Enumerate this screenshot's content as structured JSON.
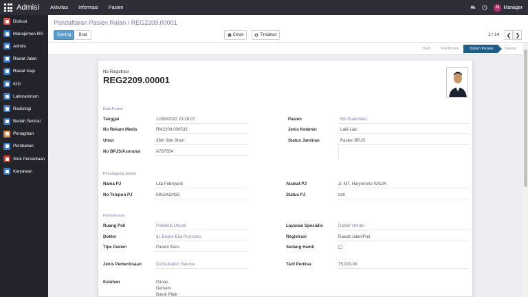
{
  "navbar": {
    "brand": "Admisi",
    "menu": [
      "Aktivitas",
      "Informasi",
      "Pasien"
    ],
    "user_initial": "M",
    "user_name": "Manager"
  },
  "sidebar": {
    "items": [
      {
        "label": "Diskusi",
        "color": "#d9534f"
      },
      {
        "label": "Manajemen RS",
        "color": "#3a7dc9"
      },
      {
        "label": "Admisi",
        "color": "#3a7dc9"
      },
      {
        "label": "Rawat Jalan",
        "color": "#3a7dc9"
      },
      {
        "label": "Rawat Inap",
        "color": "#3a7dc9"
      },
      {
        "label": "IGD",
        "color": "#3a7dc9"
      },
      {
        "label": "Laboratorium",
        "color": "#3a7dc9"
      },
      {
        "label": "Radiologi",
        "color": "#3a7dc9"
      },
      {
        "label": "Bedah Sentral",
        "color": "#3a7dc9"
      },
      {
        "label": "Penagihan",
        "color": "#e08a3a"
      },
      {
        "label": "Pembelian",
        "color": "#3a7dc9"
      },
      {
        "label": "Stok Persediaan",
        "color": "#c0392b"
      },
      {
        "label": "Karyawan",
        "color": "#3a7dc9"
      }
    ]
  },
  "control": {
    "breadcrumb": "Pendaftaran Pasien Ralan / REG2209.00001",
    "edit_label": "Sunting",
    "create_label": "Buat",
    "print_label": "Cetak",
    "action_label": "Tindakan",
    "pager": "1 / 14",
    "prev": "❮",
    "next": "❯"
  },
  "status_stages": [
    {
      "label": "Draft",
      "active": false
    },
    {
      "label": "Konfirmasi",
      "active": false
    },
    {
      "label": "Dalam Proses",
      "active": true
    },
    {
      "label": "Selesai",
      "active": false
    }
  ],
  "form": {
    "reg_label": "No Registrasi",
    "reg_number": "REG2209.00001",
    "section_patient": "Data Pasien",
    "tanggal_label": "Tanggal",
    "tanggal": "12/09/2022 23:28:07",
    "rekam_label": "No Rekam Medis",
    "rekam": "RM2209.000533",
    "umur_label": "Umur",
    "umur": "36th 3bln 9hari",
    "bpjs_label": "No BPJS/Asuransi",
    "bpjs": "A787654",
    "pasien_label": "Pasien",
    "pasien": "Edi Suatmoko",
    "kelamin_label": "Jenis Kelamin",
    "kelamin": "Laki-Laki",
    "jaminan_label": "Status Jaminan",
    "jaminan": "Pasien BPJS",
    "section_pj": "Penanggung Jawab",
    "nama_pj_label": "Nama PJ",
    "nama_pj": "Lita Febriyanti",
    "telp_pj_label": "No Telepon PJ",
    "telp_pj": "0816432432",
    "alamat_pj_label": "Alamat PJ",
    "alamat_pj": "Jl. MT. Haryonono IV/134",
    "status_pj_label": "Status PJ",
    "status_pj": "Istri",
    "section_exam": "Pemeriksaan",
    "poli_label": "Ruang Poli",
    "poli": "Poliklinik Umum",
    "dokter_label": "Dokter",
    "dokter": "dr. Boyke Eka Purnomo",
    "tipe_label": "Tipe Pasien",
    "tipe": "Pasien Baru",
    "layanan_label": "Layanan Spesialis",
    "layanan": "Dokter Umum",
    "registrasi_label": "Registrasi",
    "registrasi": "Rawat Jalan/Poli",
    "hamil_label": "Sedang Hamil",
    "jenis_periksa_label": "Jenis Pemeriksaan",
    "jenis_periksa": "Consultation Service",
    "tarif_label": "Tarif Periksa",
    "tarif": "75.000,00",
    "keluhan_label": "Keluhan",
    "keluhan": [
      "Panas",
      "Demam",
      "Batuk Pilek"
    ]
  }
}
